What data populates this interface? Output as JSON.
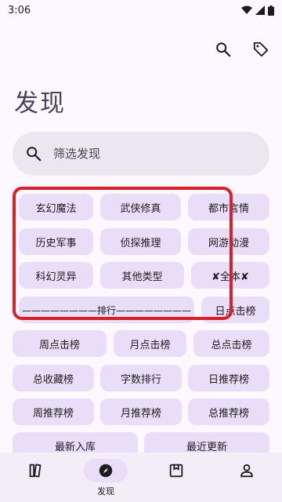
{
  "status_bar": {
    "time": "3:06"
  },
  "header": {
    "title": "发现"
  },
  "search": {
    "placeholder": "筛选发现"
  },
  "chips": [
    {
      "label": "玄幻魔法"
    },
    {
      "label": "武侠修真"
    },
    {
      "label": "都市言情"
    },
    {
      "label": "历史军事"
    },
    {
      "label": "侦探推理"
    },
    {
      "label": "网游动漫"
    },
    {
      "label": "科幻灵异"
    },
    {
      "label": "其他类型"
    },
    {
      "label": "✘全本✘"
    },
    {
      "label": "————————排行————————"
    },
    {
      "label": "日点击榜"
    },
    {
      "label": "周点击榜"
    },
    {
      "label": "月点击榜"
    },
    {
      "label": "总点击榜"
    },
    {
      "label": "总收藏榜"
    },
    {
      "label": "字数排行"
    },
    {
      "label": "日推荐榜"
    },
    {
      "label": "周推荐榜"
    },
    {
      "label": "月推荐榜"
    },
    {
      "label": "总推荐榜"
    },
    {
      "label": "最新入库"
    },
    {
      "label": "最近更新"
    }
  ],
  "bottom_nav": {
    "items": [
      {
        "icon": "bookshelf-icon",
        "label": ""
      },
      {
        "icon": "compass-icon",
        "label": "发现",
        "active": true
      },
      {
        "icon": "rss-icon",
        "label": ""
      },
      {
        "icon": "person-icon",
        "label": ""
      }
    ]
  },
  "colors": {
    "background": "#fdf7ff",
    "chip": "#e8def8",
    "search": "#ece6f0",
    "highlight_border": "#d81f2a"
  }
}
